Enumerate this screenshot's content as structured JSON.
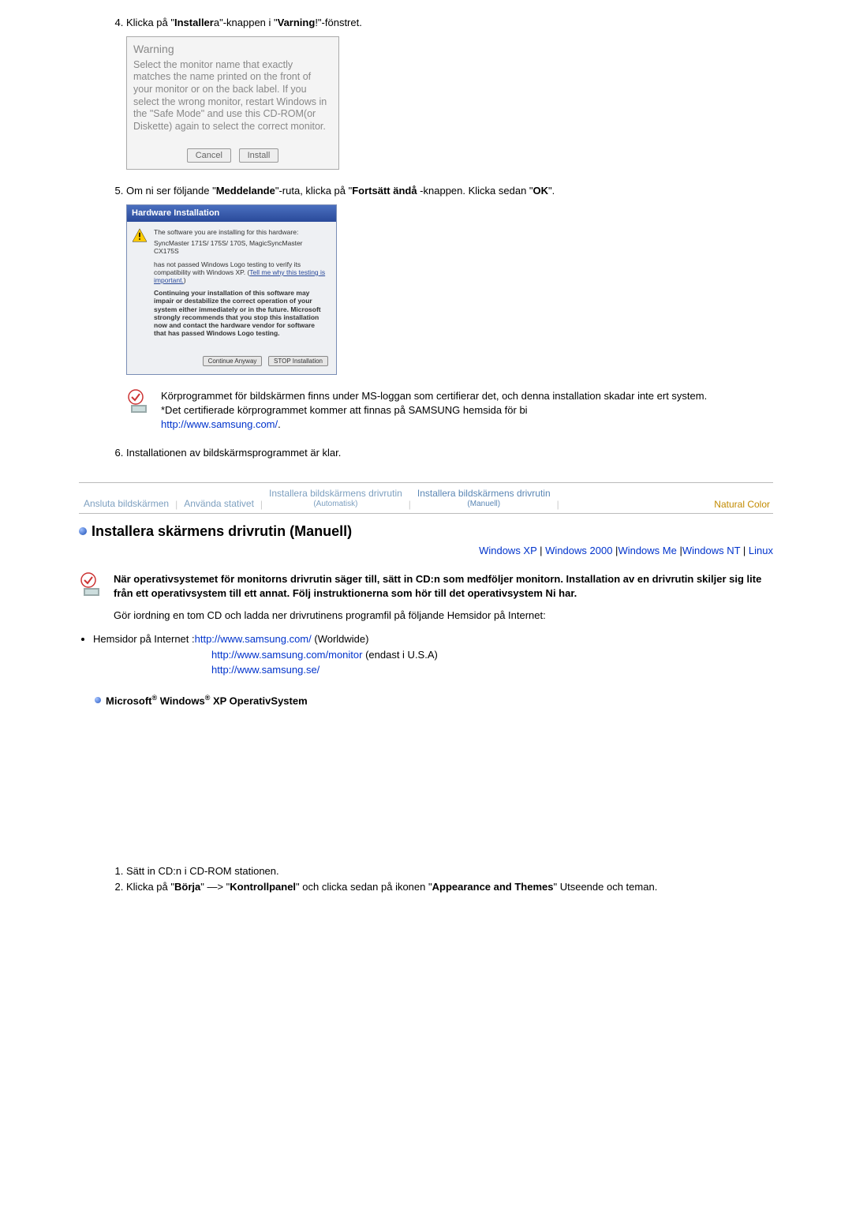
{
  "step4": {
    "prefix": "Klicka på \"",
    "word1": "Installer",
    "mid1": "a\"-knappen i \"",
    "word2": "Varning",
    "suffix": "!\"-fönstret."
  },
  "warningBox": {
    "title": "Warning",
    "body": "Select the monitor name that exactly matches the name printed on the front of your monitor or on the back label. If you select the wrong monitor, restart Windows in the \"Safe Mode\" and use this CD-ROM(or Diskette) again to select the correct monitor.",
    "cancel": "Cancel",
    "install": "Install"
  },
  "step5": {
    "prefix": "Om ni ser följande \"",
    "word1": "Meddelande",
    "mid1": "\"-ruta, klicka på \"",
    "word2": "Fortsätt ändå",
    "mid2": " -knappen. Klicka sedan \"",
    "word3": "OK",
    "suffix": "\"."
  },
  "hwBox": {
    "title": "Hardware Installation",
    "line1": "The software you are installing for this hardware:",
    "line2": "SyncMaster 171S/ 175S/ 170S, MagicSyncMaster CX175S",
    "line3a": "has not passed Windows Logo testing to verify its compatibility with Windows XP. (",
    "line3link": "Tell me why this testing is important.",
    "line3b": ")",
    "boldBlock": "Continuing your installation of this software may impair or destabilize the correct operation of your system either immediately or in the future. Microsoft strongly recommends that you stop this installation now and contact the hardware vendor for software that has passed Windows Logo testing.",
    "btnContinue": "Continue Anyway",
    "btnStop": "STOP Installation"
  },
  "note": {
    "line1": "Körprogrammet för bildskärmen finns under MS-loggan som certifierar det, och denna installation skadar inte ert system.",
    "line2": "*Det certifierade körprogrammet kommer att finnas på SAMSUNG hemsida för bi",
    "link": "http://www.samsung.com/",
    "after": "."
  },
  "step6": "Installationen av bildskärmsprogrammet är klar.",
  "tabs": {
    "t1": "Ansluta bildskärmen",
    "t2": "Använda stativet",
    "t3a": "Installera bildskärmens drivrutin",
    "t3b": "(Automatisk)",
    "t4a": "Installera bildskärmens drivrutin",
    "t4b": "(Manuell)",
    "nc": "Natural Color"
  },
  "sectionTitle": "Installera skärmens drivrutin (Manuell)",
  "osLinks": {
    "xp": "Windows XP",
    "w2k": "Windows 2000",
    "wme": "Windows Me",
    "wnt": "Windows NT",
    "linux": "Linux"
  },
  "intro": {
    "bold": "När operativsystemet för monitorns drivrutin säger till, sätt in CD:n som medföljer monitorn. Installation av en drivrutin skiljer sig lite från ett operativsystem till ett annat. Följ instruktionerna som hör till det operativsystem Ni har.",
    "plain": "Gör iordning en tom CD och ladda ner drivrutinens programfil på följande Hemsidor på Internet:"
  },
  "hemsidor": {
    "label": "Hemsidor på Internet :",
    "l1": "http://www.samsung.com/",
    "l1after": " (Worldwide)",
    "l2": "http://www.samsung.com/monitor",
    "l2after": " (endast i U.S.A)",
    "l3": "http://www.samsung.se/"
  },
  "subHeading": {
    "ms": "Microsoft",
    "reg": "®",
    "win": " Windows",
    "xp": " XP OperativSystem"
  },
  "steps2": {
    "s1": "Sätt in CD:n i CD-ROM stationen.",
    "s2a": "Klicka på \"",
    "s2b": "Börja",
    "s2c": "\" —> \"",
    "s2d": "Kontrollpanel",
    "s2e": "\" och clicka sedan på ikonen \"",
    "s2f": "Appearance and Themes",
    "s2g": "\" Utseende och teman."
  }
}
